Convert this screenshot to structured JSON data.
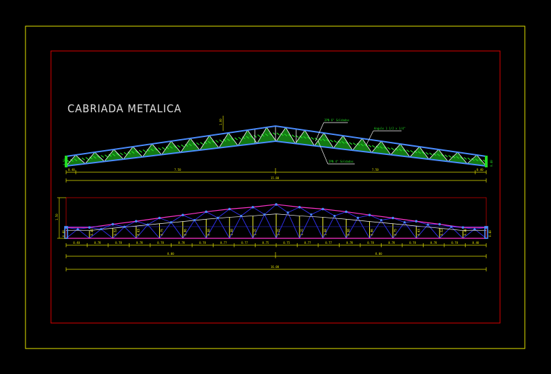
{
  "title": "CABRIADA METALICA",
  "colors": {
    "background": "#000000",
    "outer_frame": "#e6e600",
    "inner_frame": "#e00000",
    "truss_chord": "#4a8cff",
    "bracing": "#ffffff",
    "hatch": "#22dd22",
    "profile": "#ff33cc",
    "verticals": "#ffff33",
    "diagonals": "#3333ff",
    "dims": "#ffff00"
  },
  "top_truss": {
    "left_height": "0.50",
    "ridge_height": "1.00",
    "dims": {
      "end_left": "0.40",
      "half_left": "7.50",
      "half_right": "7.50",
      "end_right": "0.40",
      "total": "15.80"
    },
    "callouts": [
      "2PN 6\" Soldadas",
      "Angulo 1 1/2 x 1/4\"",
      "2PN 4\" Soldadas"
    ]
  },
  "bottom_truss": {
    "left_height": "1.50",
    "end_heights": [
      "0.40",
      "0.40"
    ],
    "vertical_heights": [
      "0.40",
      "0.52",
      "0.63",
      "0.75",
      "0.86",
      "0.98",
      "1.08",
      "1.15",
      "1.25",
      "1.15",
      "1.08",
      "0.98",
      "0.86",
      "0.75",
      "0.63",
      "0.52",
      "0.40"
    ],
    "spacings": [
      "0.40",
      "0.78",
      "0.78",
      "0.78",
      "0.78",
      "0.78",
      "0.78",
      "0.77",
      "0.77",
      "0.75",
      "0.75",
      "0.77",
      "0.77",
      "0.78",
      "0.78",
      "0.78",
      "0.78",
      "0.78",
      "0.78",
      "0.40"
    ],
    "dims": {
      "half_left": "8.00",
      "half_right": "8.00",
      "total": "16.00"
    }
  }
}
